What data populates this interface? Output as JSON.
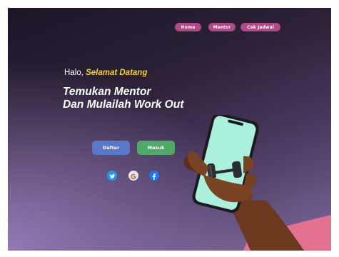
{
  "nav": {
    "items": [
      {
        "label": "Home"
      },
      {
        "label": "Mentor"
      },
      {
        "label": "Cek Jadwal"
      }
    ]
  },
  "hero": {
    "greeting_prefix": "Halo,",
    "greeting_highlight": "Selamat Datang",
    "headline_line1": "Temukan Mentor",
    "headline_line2": "Dan Mulailah Work Out"
  },
  "buttons": {
    "register_label": "Daftar",
    "login_label": "Masuk"
  },
  "social": {
    "icons": [
      "twitter-icon",
      "google-icon",
      "facebook-icon"
    ]
  },
  "colors": {
    "nav_pill": "#b04a86",
    "highlight": "#f6d21a",
    "register_button": "#5a78c8",
    "login_button": "#4faa6a",
    "phone_screen": "#aaf0dc"
  }
}
